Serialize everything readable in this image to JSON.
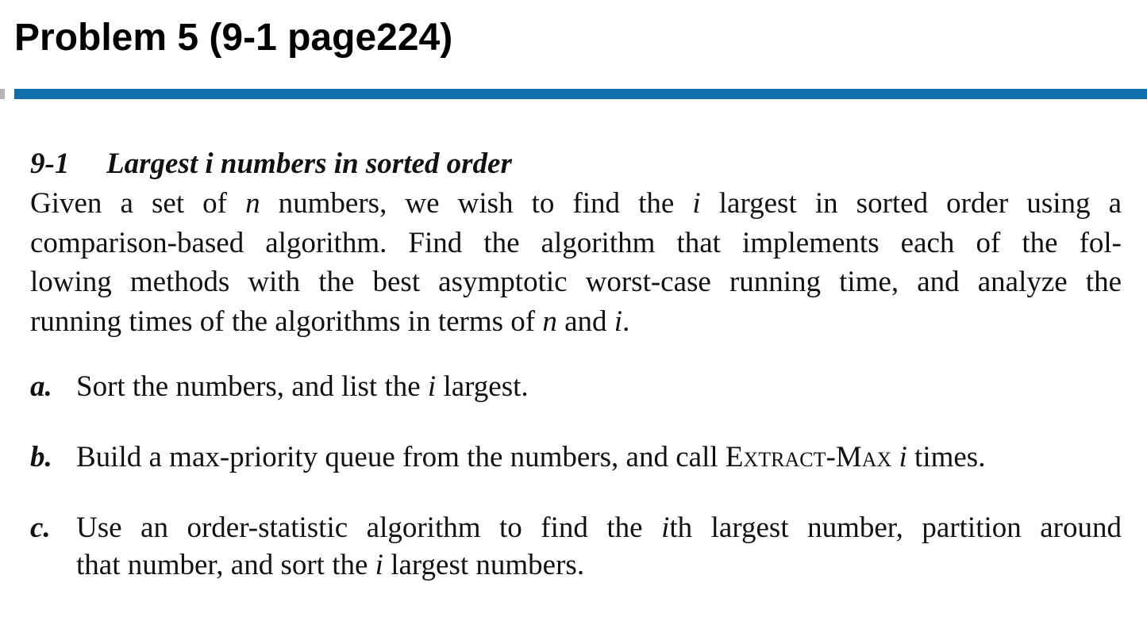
{
  "slide": {
    "title": "Problem 5 (9-1 page224)",
    "rule_color": "#0f6fab"
  },
  "problem": {
    "number": "9-1",
    "heading_pre": "Largest",
    "heading_var": "i",
    "heading_post": "numbers in sorted order",
    "body": {
      "l1_a": "Given a set of",
      "l1_n": "n",
      "l1_b": "numbers, we wish to find the",
      "l1_i": "i",
      "l1_c": "largest in sorted order using a",
      "l2": "comparison-based algorithm. Find the algorithm that implements each of the fol-",
      "l3": "lowing methods with the best asymptotic worst-case running time, and analyze the",
      "l4_a": "running times of the algorithms in terms of",
      "l4_n": "n",
      "l4_b": "and",
      "l4_i": "i",
      "l4_c": "."
    },
    "items": [
      {
        "label": "a.",
        "t1": "Sort the numbers, and list the",
        "v1": "i",
        "t2": "largest."
      },
      {
        "label": "b.",
        "t1": "Build a max-priority queue from the numbers, and call",
        "sc": "Extract-Max",
        "v1": "i",
        "t2": "times."
      },
      {
        "label": "c.",
        "t1": "Use an order-statistic algorithm to find the",
        "v1": "i",
        "t2": "th largest number, partition around",
        "t3": "that number, and sort the",
        "v2": "i",
        "t4": "largest numbers."
      }
    ]
  }
}
